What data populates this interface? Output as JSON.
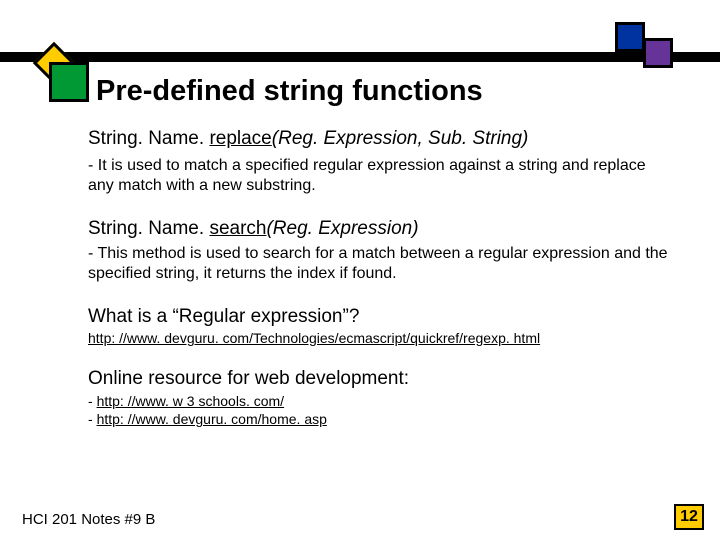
{
  "title": "Pre-defined string functions",
  "sig1": {
    "prefix": "String. Name. ",
    "method": "replace",
    "args": "(Reg. Expression, Sub. String)"
  },
  "desc1": "- It is used to match a specified regular expression against a string and replace any match with a new substring.",
  "sig2": {
    "prefix": "String. Name. ",
    "method": "search",
    "args": "(Reg. Expression)"
  },
  "desc2": "- This method is used to search for a match between a regular expression and the specified string, it returns the index if found.",
  "regex_q": "What is a “Regular expression”?",
  "regex_link": "http: //www. devguru. com/Technologies/ecmascript/quickref/regexp. html",
  "online_head": "Online resource for web development:",
  "online_dash": "- ",
  "online_link1": "http: //www. w 3 schools. com/",
  "online_link2": "http: //www. devguru. com/home. asp",
  "footer": "HCI 201 Notes #9 B",
  "page": "12"
}
